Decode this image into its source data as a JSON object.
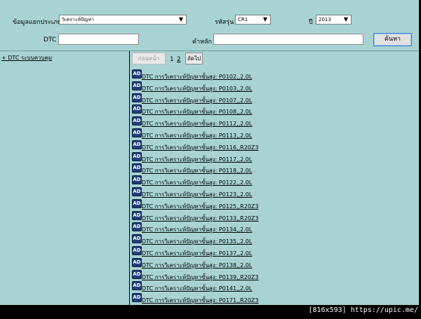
{
  "filters": {
    "category_label": "ข้อมูลแยกประเภท",
    "category_value": "วิเคราะห์ปัญหา",
    "model_label": "รหัสรุ่น",
    "model_value": "CR1",
    "year_label": "ปี",
    "year_value": "2013",
    "dtc_label": "DTC",
    "dtc_value": "",
    "keyword_label": "คำหลัก",
    "keyword_value": "",
    "search_button": "ค้นหา"
  },
  "tree": {
    "root_label": "+ DTC ระบบควบคุม"
  },
  "pagination": {
    "prev_label": "ก่อนหน้า",
    "page1": "1",
    "page2": "2",
    "next_label": "ถัดไป"
  },
  "results": {
    "icon_text": "AD",
    "items": [
      "DTC การวิเคราะห์ปัญหาขั้นสูง: P0102,,2.0L",
      "DTC การวิเคราะห์ปัญหาขั้นสูง: P0103,,2.0L",
      "DTC การวิเคราะห์ปัญหาขั้นสูง: P0107,,2.0L",
      "DTC การวิเคราะห์ปัญหาขั้นสูง: P0108,,2.0L",
      "DTC การวิเคราะห์ปัญหาขั้นสูง: P0112,,2.0L",
      "DTC การวิเคราะห์ปัญหาขั้นสูง: P0113,,2.0L",
      "DTC การวิเคราะห์ปัญหาขั้นสูง: P0116,,R20Z3",
      "DTC การวิเคราะห์ปัญหาขั้นสูง: P0117,,2.0L",
      "DTC การวิเคราะห์ปัญหาขั้นสูง: P0118,,2.0L",
      "DTC การวิเคราะห์ปัญหาขั้นสูง: P0122,,2.0L",
      "DTC การวิเคราะห์ปัญหาขั้นสูง: P0123,,2.0L",
      "DTC การวิเคราะห์ปัญหาขั้นสูง: P0125,,R20Z3",
      "DTC การวิเคราะห์ปัญหาขั้นสูง: P0133,,R20Z3",
      "DTC การวิเคราะห์ปัญหาขั้นสูง: P0134,,2.0L",
      "DTC การวิเคราะห์ปัญหาขั้นสูง: P0135,,2.0L",
      "DTC การวิเคราะห์ปัญหาขั้นสูง: P0137,,2.0L",
      "DTC การวิเคราะห์ปัญหาขั้นสูง: P0138,,2.0L",
      "DTC การวิเคราะห์ปัญหาขั้นสูง: P0139,,R20Z3",
      "DTC การวิเคราะห์ปัญหาขั้นสูง: P0141,,2.0L",
      "DTC การวิเคราะห์ปัญหาขั้นสูง: P0171,,R20Z3"
    ]
  },
  "watermark": "[816x593] https://upic.me/"
}
